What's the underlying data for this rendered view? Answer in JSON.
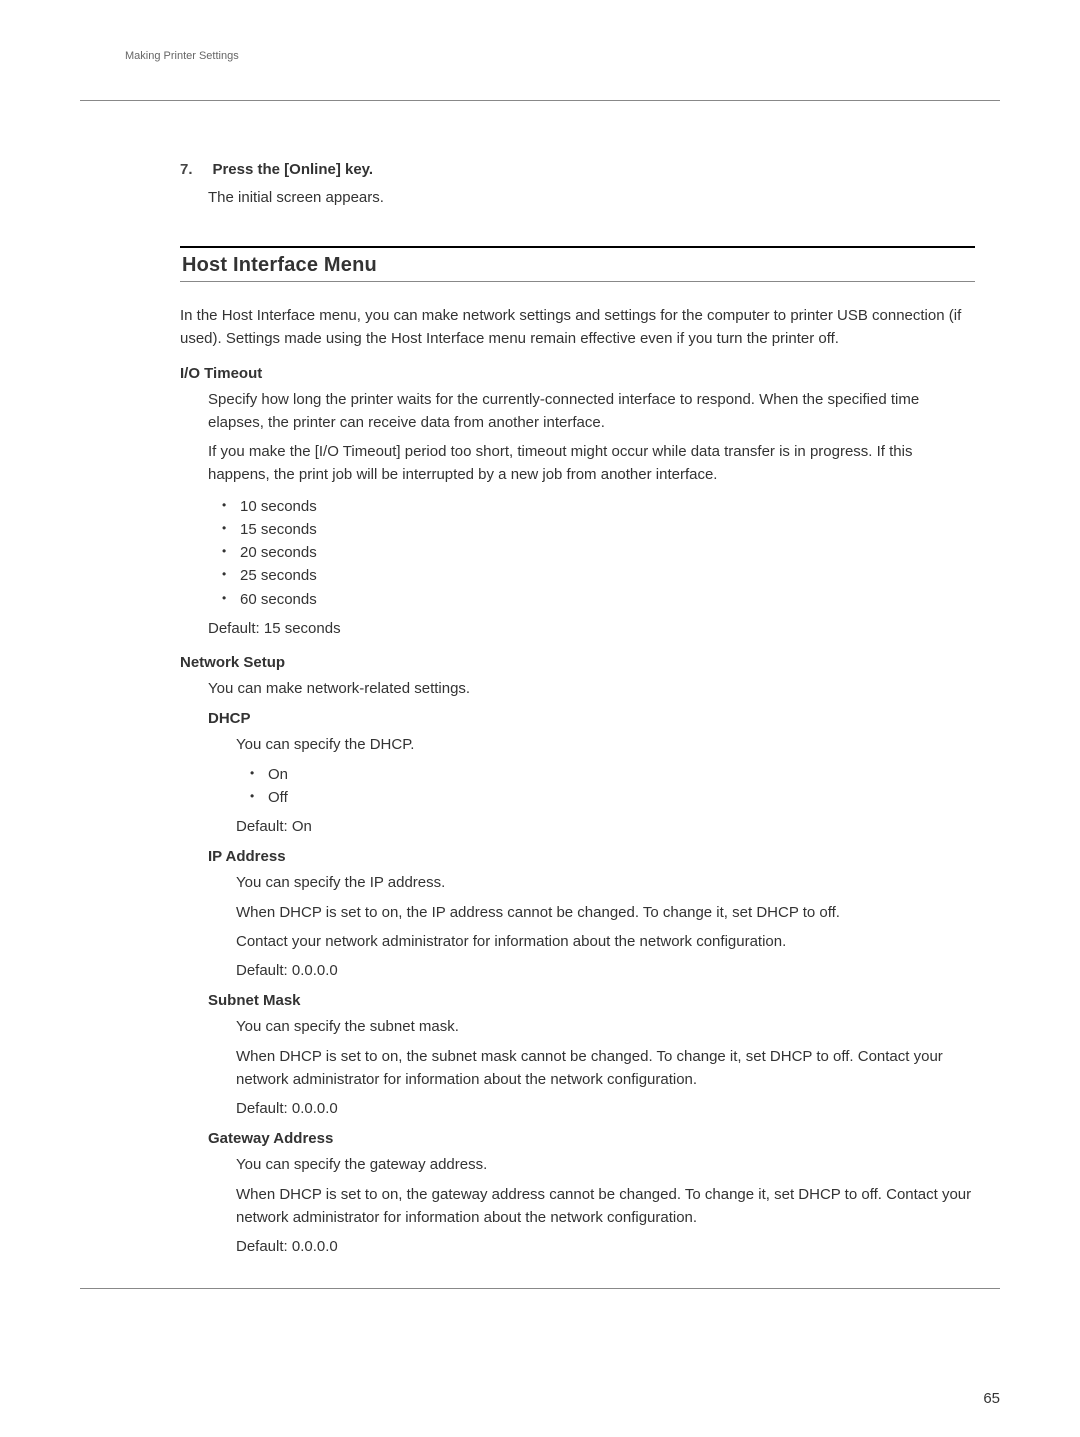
{
  "header": {
    "running_title": "Making Printer Settings"
  },
  "step7": {
    "number": "7.",
    "instruction": "Press the [Online] key.",
    "body": "The initial screen appears."
  },
  "section": {
    "title": "Host Interface Menu"
  },
  "intro": "In the Host Interface menu, you can make network settings and settings for the computer to printer USB connection (if used). Settings made using the Host Interface menu remain effective even if you turn the printer off.",
  "io_timeout": {
    "title": "I/O Timeout",
    "p1": "Specify how long the printer waits for the currently-connected interface to respond. When the specified time elapses, the printer can receive data from another interface.",
    "p2": "If you make the [I/O Timeout] period too short, timeout might occur while data transfer is in progress. If this happens, the print job will be interrupted by a new job from another interface.",
    "options": [
      "10 seconds",
      "15 seconds",
      "20 seconds",
      "25 seconds",
      "60 seconds"
    ],
    "default": "Default: 15 seconds"
  },
  "network_setup": {
    "title": "Network Setup",
    "intro": "You can make network-related settings.",
    "dhcp": {
      "title": "DHCP",
      "body": "You can specify the DHCP.",
      "options": [
        "On",
        "Off"
      ],
      "default": "Default: On"
    },
    "ip": {
      "title": "IP Address",
      "p1": "You can specify the IP address.",
      "p2": "When DHCP is set to on, the IP address cannot be changed. To change it, set DHCP to off.",
      "p3": "Contact your network administrator for information about the network configuration.",
      "default": "Default: 0.0.0.0"
    },
    "subnet": {
      "title": "Subnet Mask",
      "p1": "You can specify the subnet mask.",
      "p2": "When DHCP is set to on, the subnet mask cannot be changed. To change it, set DHCP to off. Contact your network administrator for information about the network configuration.",
      "default": "Default: 0.0.0.0"
    },
    "gateway": {
      "title": "Gateway Address",
      "p1": "You can specify the gateway address.",
      "p2": "When DHCP is set to on, the gateway address cannot be changed. To change it, set DHCP to off. Contact your network administrator for information about the network configuration.",
      "default": "Default: 0.0.0.0"
    }
  },
  "page_number": "65"
}
